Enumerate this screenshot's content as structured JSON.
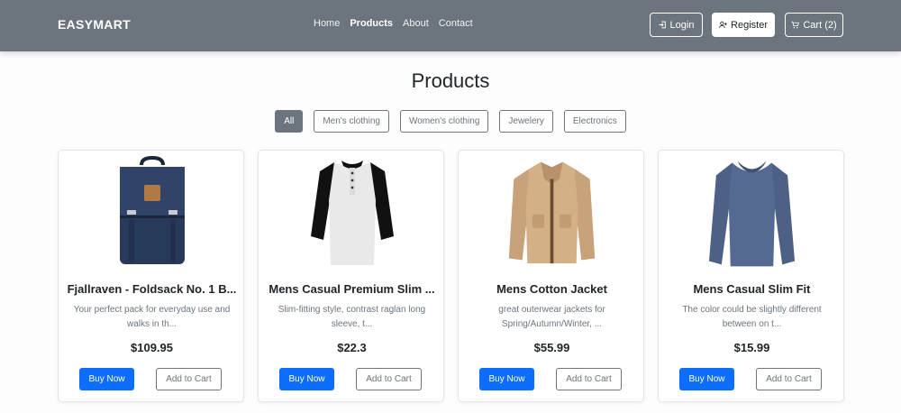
{
  "nav": {
    "brand": "EASYMART",
    "links": [
      "Home",
      "Products",
      "About",
      "Contact"
    ],
    "login_label": "Login",
    "register_label": "Register",
    "cart_label": "Cart (2)"
  },
  "page_title": "Products",
  "filters": [
    "All",
    "Men's clothing",
    "Women's clothing",
    "Jewelery",
    "Electronics"
  ],
  "active_filter": "All",
  "products": [
    {
      "title": "Fjallraven - Foldsack No. 1 B...",
      "description": "Your perfect pack for everyday use and walks in th...",
      "price": "$109.95",
      "image": "backpack"
    },
    {
      "title": "Mens Casual Premium Slim ...",
      "description": "Slim-fitting style, contrast raglan long sleeve, t...",
      "price": "$22.3",
      "image": "raglan-shirt"
    },
    {
      "title": "Mens Cotton Jacket",
      "description": "great outerwear jackets for Spring/Autumn/Winter, ...",
      "price": "$55.99",
      "image": "jacket"
    },
    {
      "title": "Mens Casual Slim Fit",
      "description": "The color could be slightly different between on t...",
      "price": "$15.99",
      "image": "long-sleeve-tee"
    }
  ],
  "buy_label": "Buy Now",
  "add_cart_label": "Add to Cart",
  "colors": {
    "navbar": "#6c757d",
    "primary": "#0d6efd",
    "secondary": "#6c757d"
  }
}
